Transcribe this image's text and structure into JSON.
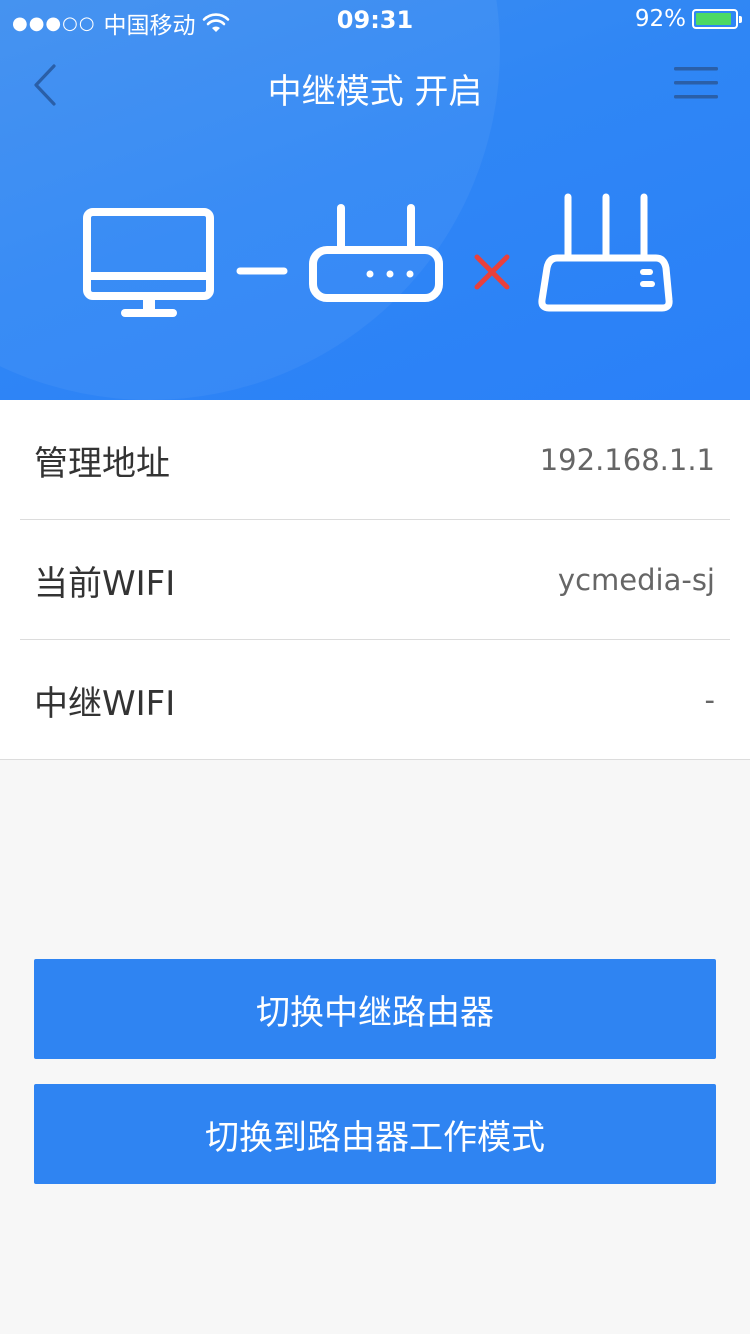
{
  "status_bar": {
    "signal_dots": "●●●○○",
    "carrier": "中国移动",
    "time": "09:31",
    "battery_percent": "92%",
    "battery_level": 0.92
  },
  "nav": {
    "title": "中继模式 开启",
    "back_icon": "chevron-left-icon",
    "menu_icon": "hamburger-menu-icon"
  },
  "illustration": {
    "devices": [
      "monitor-icon",
      "router-icon",
      "router-antenna-icon"
    ],
    "connection_ok": "dash-connector",
    "connection_fail": "red-x-icon"
  },
  "info": {
    "rows": [
      {
        "label": "管理地址",
        "value": "192.168.1.1"
      },
      {
        "label": "当前WIFI",
        "value": "ycmedia-sj"
      },
      {
        "label": "中继WIFI",
        "value": "-"
      }
    ]
  },
  "actions": {
    "switch_repeater_label": "切换中继路由器",
    "switch_router_mode_label": "切换到路由器工作模式"
  },
  "colors": {
    "primary": "#2f84f2",
    "error": "#e8403c",
    "battery": "#4cd964"
  }
}
